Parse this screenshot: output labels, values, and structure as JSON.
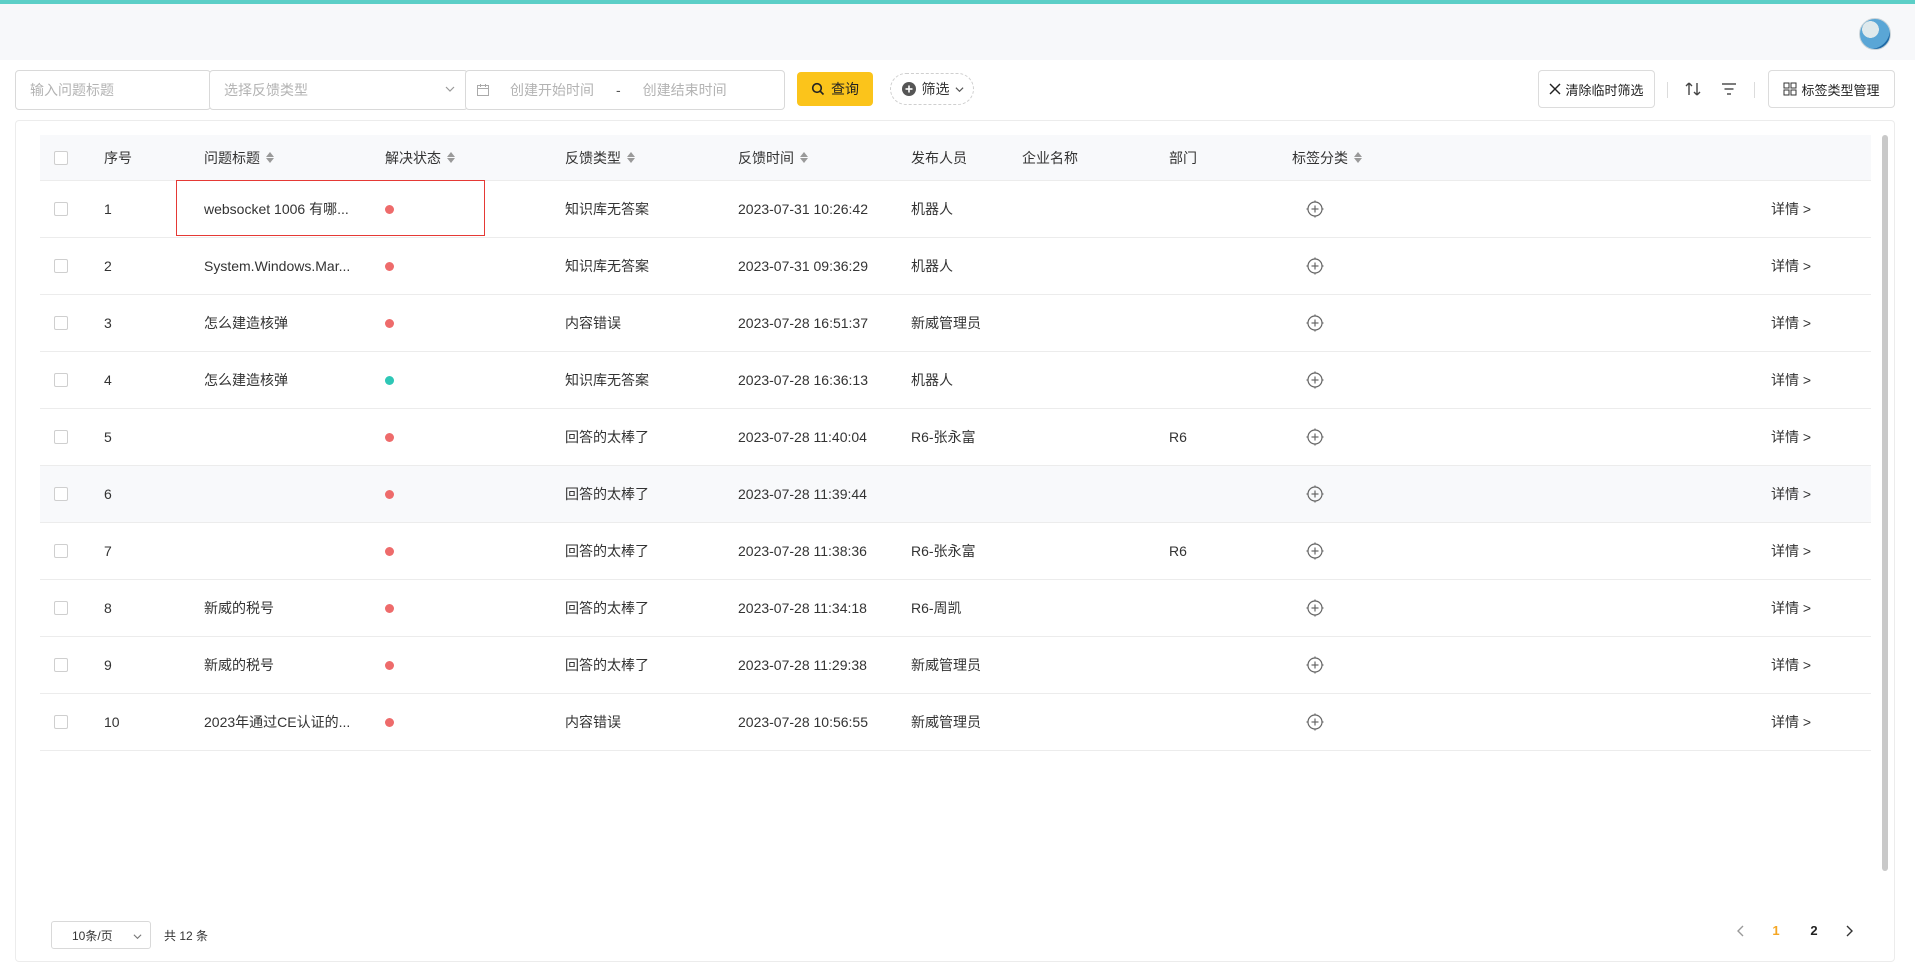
{
  "toolbar": {
    "title_placeholder": "输入问题标题",
    "type_placeholder": "选择反馈类型",
    "date_start_placeholder": "创建开始时间",
    "date_sep": "-",
    "date_end_placeholder": "创建结束时间",
    "query_label": "查询",
    "filter_label": "筛选",
    "clear_label": "清除临时筛选",
    "tag_manage_label": "标签类型管理"
  },
  "table": {
    "headers": {
      "index": "序号",
      "title": "问题标题",
      "status": "解决状态",
      "type": "反馈类型",
      "time": "反馈时间",
      "publisher": "发布人员",
      "company": "企业名称",
      "dept": "部门",
      "tags": "标签分类"
    },
    "detail_label": "详情 >",
    "rows": [
      {
        "index": "1",
        "title": "websocket 1006 有哪...",
        "status": "unresolved",
        "type": "知识库无答案",
        "time": "2023-07-31 10:26:42",
        "publisher": "机器人",
        "company": "",
        "dept": ""
      },
      {
        "index": "2",
        "title": "System.Windows.Mar...",
        "status": "unresolved",
        "type": "知识库无答案",
        "time": "2023-07-31 09:36:29",
        "publisher": "机器人",
        "company": "",
        "dept": ""
      },
      {
        "index": "3",
        "title": "怎么建造核弹",
        "status": "unresolved",
        "type": "内容错误",
        "time": "2023-07-28 16:51:37",
        "publisher": "新威管理员",
        "company": "",
        "dept": ""
      },
      {
        "index": "4",
        "title": "怎么建造核弹",
        "status": "resolved",
        "type": "知识库无答案",
        "time": "2023-07-28 16:36:13",
        "publisher": "机器人",
        "company": "",
        "dept": ""
      },
      {
        "index": "5",
        "title": "",
        "status": "unresolved",
        "type": "回答的太棒了",
        "time": "2023-07-28 11:40:04",
        "publisher": "R6-张永富",
        "company": "",
        "dept": "R6"
      },
      {
        "index": "6",
        "title": "",
        "status": "unresolved",
        "type": "回答的太棒了",
        "time": "2023-07-28 11:39:44",
        "publisher": "",
        "company": "",
        "dept": ""
      },
      {
        "index": "7",
        "title": "",
        "status": "unresolved",
        "type": "回答的太棒了",
        "time": "2023-07-28 11:38:36",
        "publisher": "R6-张永富",
        "company": "",
        "dept": "R6"
      },
      {
        "index": "8",
        "title": "新威的税号",
        "status": "unresolved",
        "type": "回答的太棒了",
        "time": "2023-07-28 11:34:18",
        "publisher": "R6-周凯",
        "company": "",
        "dept": ""
      },
      {
        "index": "9",
        "title": "新威的税号",
        "status": "unresolved",
        "type": "回答的太棒了",
        "time": "2023-07-28 11:29:38",
        "publisher": "新威管理员",
        "company": "",
        "dept": ""
      },
      {
        "index": "10",
        "title": "2023年通过CE认证的...",
        "status": "unresolved",
        "type": "内容错误",
        "time": "2023-07-28 10:56:55",
        "publisher": "新威管理员",
        "company": "",
        "dept": ""
      }
    ]
  },
  "status_colors": {
    "unresolved": "#ee6b6b",
    "resolved": "#2ec7b6"
  },
  "pagination": {
    "page_size": "10条/页",
    "total": "共 12 条",
    "pages": [
      "1",
      "2"
    ],
    "current": "1"
  },
  "icons": {
    "tag_add": "plus-circle-icon",
    "filter": "plus-circle-icon",
    "sort": "sort-arrows-icon",
    "funnel": "filter-lines-icon",
    "grid": "grid-icon"
  }
}
